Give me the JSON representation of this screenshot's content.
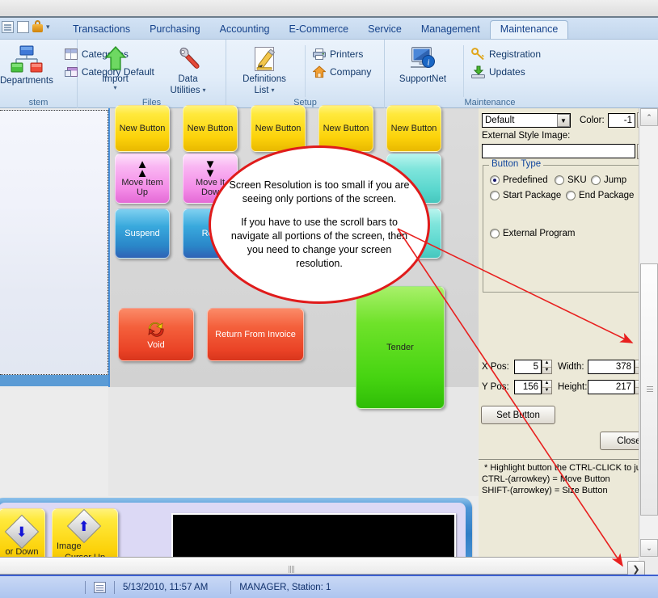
{
  "ribbon": {
    "quick_access": [
      {
        "name": "app-menu-icon",
        "glyph": "▤"
      },
      {
        "name": "new-document-icon",
        "glyph": "▭"
      },
      {
        "name": "lock-icon",
        "glyph": "🔒"
      },
      {
        "name": "customize-qat-caret",
        "glyph": "▾"
      }
    ],
    "tabs": [
      {
        "label": "Transactions",
        "active": false
      },
      {
        "label": "Purchasing",
        "active": false
      },
      {
        "label": "Accounting",
        "active": false
      },
      {
        "label": "E-Commerce",
        "active": false
      },
      {
        "label": "Service",
        "active": false
      },
      {
        "label": "Management",
        "active": false
      },
      {
        "label": "Maintenance",
        "active": true
      }
    ],
    "groups": [
      {
        "title": "stem",
        "big": [
          {
            "label": "Departments",
            "icon": "org-chart-icon",
            "caret": ""
          }
        ],
        "small": [
          {
            "label": "Categories",
            "icon": "categories-icon"
          },
          {
            "label": "Category Default",
            "icon": "category-default-icon"
          }
        ]
      },
      {
        "title": "Files",
        "big": [
          {
            "label": "Import",
            "icon": "import-arrow-icon",
            "caret": "▾"
          },
          {
            "label": "Data\nUtilities",
            "icon": "wrench-icon",
            "caret": "▾"
          }
        ],
        "small": []
      },
      {
        "title": "Setup",
        "big": [
          {
            "label": "Definitions\nList",
            "icon": "pencil-icon",
            "caret": "▾"
          }
        ],
        "small": [
          {
            "label": "Printers",
            "icon": "printer-icon"
          },
          {
            "label": "Company",
            "icon": "company-home-icon"
          }
        ]
      },
      {
        "title": "Maintenance",
        "big": [
          {
            "label": "SupportNet",
            "icon": "support-monitor-icon",
            "caret": ""
          }
        ],
        "small": [
          {
            "label": "Registration",
            "icon": "key-icon"
          },
          {
            "label": "Updates",
            "icon": "updates-download-icon"
          }
        ]
      }
    ],
    "group_labels": {
      "g0": "stem",
      "g1": "Files",
      "g2": "Setup",
      "g3": "Maintenance"
    },
    "big_labels": {
      "departments": "Departments",
      "import": "Import",
      "data_utilities_1": "Data",
      "data_utilities_2": "Utilities",
      "definitions_1": "Definitions",
      "definitions_2": "List",
      "supportnet": "SupportNet"
    },
    "small_labels": {
      "categories": "Categories",
      "category_default": "Category Default",
      "printers": "Printers",
      "company": "Company",
      "registration": "Registration",
      "updates": "Updates"
    }
  },
  "designer": {
    "buttons": [
      {
        "caption": "New Button",
        "color": "yellow"
      },
      {
        "caption": "New Button",
        "color": "yellow"
      },
      {
        "caption": "New Button",
        "color": "yellow"
      },
      {
        "caption": "New Button",
        "color": "yellow"
      },
      {
        "caption": "New Button",
        "color": "yellow"
      },
      {
        "caption": "Move Item Up",
        "color": "pink",
        "icon": "double-up-arrow-icon"
      },
      {
        "caption": "Move Item Down",
        "color": "pink",
        "icon": "double-down-arrow-icon"
      },
      {
        "caption": "Suspend",
        "color": "blue"
      },
      {
        "caption": "Retrieve",
        "color": "blue"
      },
      {
        "caption": "Void",
        "color": "red",
        "icon": "void-swirl-icon"
      },
      {
        "caption": "Return From Invoice",
        "color": "red"
      },
      {
        "caption": "Tender",
        "color": "green"
      }
    ],
    "button_labels": {
      "new_button": "New Button",
      "move_item_up_1": "Move Item",
      "move_item_up_2": "Up",
      "move_item_down_1": "Move It",
      "move_item_down_2": "Dow",
      "suspend": "Suspend",
      "retrieve": "Retr",
      "void": "Void",
      "return_from_invoice": "Return From Invoice",
      "tender": "Tender"
    }
  },
  "toolbar": {
    "cursor_down_label": "or Down",
    "image_label": "Image",
    "cursor_up_label": "Cursor Up"
  },
  "properties": {
    "style_combo_value": "Default",
    "color_label": "Color:",
    "color_value": "-1",
    "external_style_image_label": "External Style Image:",
    "external_style_image_value": "",
    "button_type_title": "Button Type",
    "radios": [
      {
        "label": "Predefined",
        "selected": true
      },
      {
        "label": "SKU",
        "selected": false
      },
      {
        "label": "Jump",
        "selected": false
      },
      {
        "label": "Start Package",
        "selected": false
      },
      {
        "label": "End Package",
        "selected": false
      },
      {
        "label": "External Program",
        "selected": false
      }
    ],
    "radio_labels": {
      "predefined": "Predefined",
      "sku": "SKU",
      "jump": "Jump",
      "start_package": "Start Package",
      "end_package": "End Package",
      "external_program": "External Program"
    },
    "xpos_label": "X Pos:",
    "xpos_value": "5",
    "width_label": "Width:",
    "width_value": "378",
    "ypos_label": "Y Pos:",
    "ypos_value": "156",
    "height_label": "Height:",
    "height_value": "217",
    "set_button_label": "Set Button",
    "close_label": "Close",
    "hints": [
      "* Highlight button the CTRL-CLICK to ju",
      "CTRL-(arrowkey) = Move Button",
      "SHIFT-(arrowkey) = Size Button"
    ],
    "hint_lines": {
      "l1": "* Highlight button the CTRL-CLICK to ju",
      "l2": "CTRL-(arrowkey) = Move Button",
      "l3": "SHIFT-(arrowkey) = Size Button"
    },
    "ellipsis_label": "...",
    "ellipsis_label_2": "."
  },
  "callout": {
    "paragraph_1": "Screen Resolution is too small if you are seeing only portions of the screen.",
    "paragraph_2": "If you have to use the scroll bars to navigate all portions of the screen, then you need to change your screen resolution.",
    "border_color": "#e01b1b",
    "arrow_color": "#e8201f"
  },
  "statusbar": {
    "datetime": "5/13/2010, 11:57 AM",
    "user_station": "MANAGER, Station: 1",
    "icon": "document-status-icon"
  },
  "scrollbars": {
    "v_up_glyph": "⌃",
    "v_down_glyph": "⌄",
    "corner_glyph": "❯"
  },
  "colors": {
    "ribbon_blue": "#cfe0f3",
    "tab_text": "#15428b",
    "panel_beige": "#ece9d8",
    "annotation_red": "#e8201f",
    "status_blue": "#aec5ef",
    "designer_border": "#4a90d9"
  }
}
